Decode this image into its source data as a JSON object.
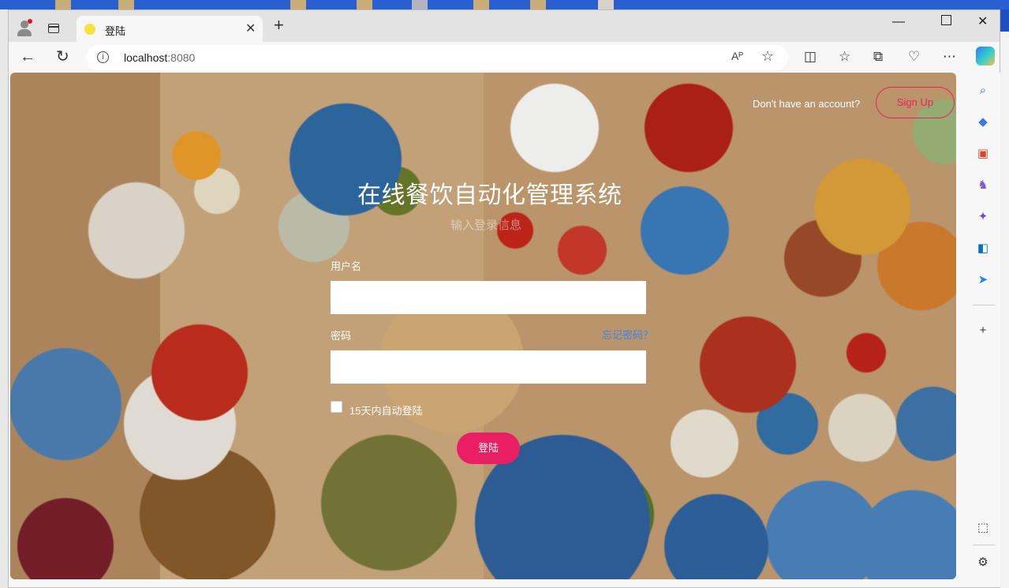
{
  "browser": {
    "tab_title": "登陆",
    "url_host": "localhost",
    "url_port": ":8080",
    "read_aloud_glyph": "Aᴾ"
  },
  "page": {
    "signup_prompt": "Don't have an account?",
    "signup_button": "Sign Up",
    "title": "在线餐饮自动化管理系统",
    "subtitle": "输入登录信息",
    "username_label": "用户名",
    "password_label": "密码",
    "forgot_password": "忘记密码？",
    "remember_label": "15天内自动登陆",
    "login_button": "登陆"
  },
  "colors": {
    "accent": "#e91e63",
    "link": "#3a86e8"
  },
  "icons": [
    "profile-icon",
    "tab-actions-icon",
    "close-icon",
    "new-tab-icon",
    "minimize-icon",
    "maximize-icon",
    "window-close-icon",
    "back-icon",
    "refresh-icon",
    "info-icon",
    "read-aloud-icon",
    "favorite-icon",
    "split-screen-icon",
    "favorites-icon",
    "collections-icon",
    "browser-essentials-icon",
    "more-icon",
    "copilot-icon",
    "search-icon",
    "shopping-icon",
    "tools-icon",
    "games-icon",
    "m365-icon",
    "outlook-icon",
    "send-icon",
    "add-icon",
    "screenshot-icon",
    "settings-icon"
  ]
}
